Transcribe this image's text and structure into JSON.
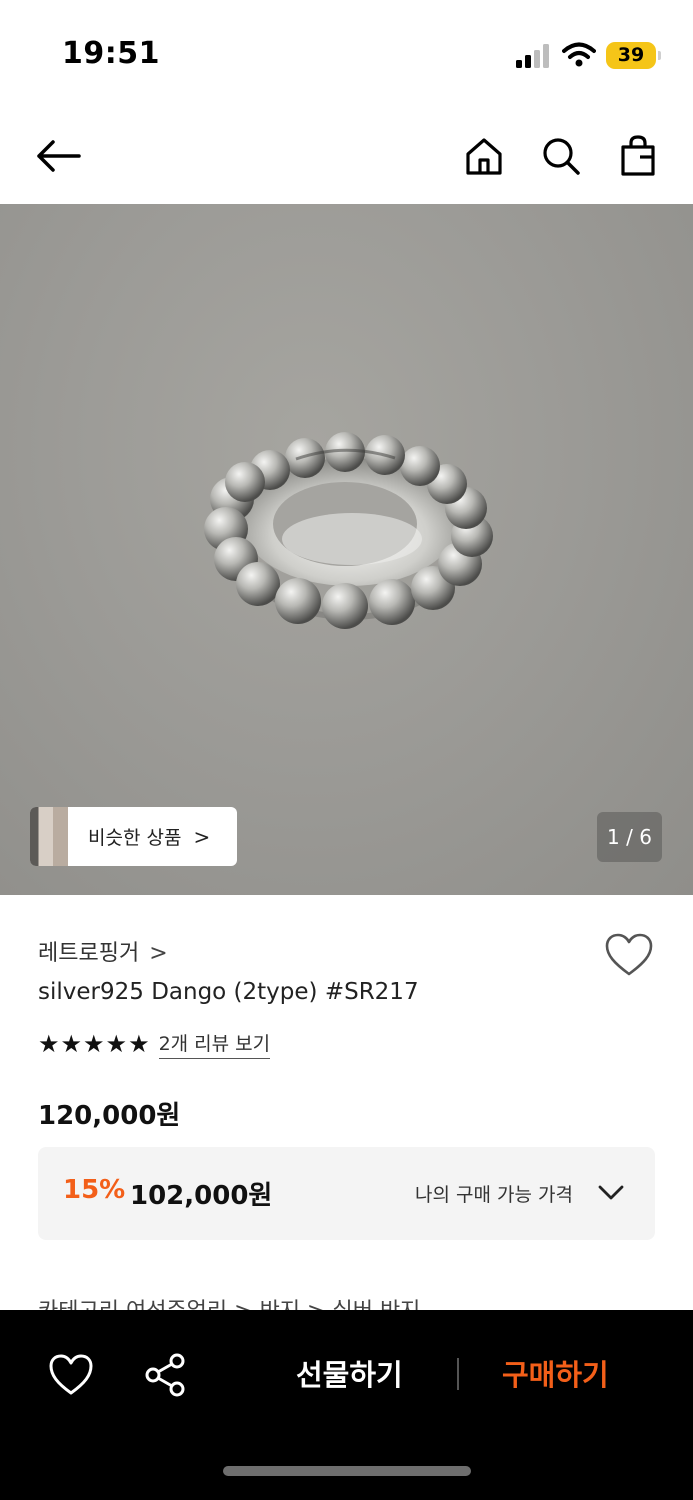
{
  "status_bar": {
    "time": "19:51",
    "battery": "39"
  },
  "nav": {
    "back_icon": "arrow-left-icon",
    "home_icon": "home-icon",
    "search_icon": "search-icon",
    "bag_icon": "shopping-bag-icon"
  },
  "gallery": {
    "similar_label": "비슷한 상품",
    "similar_chevron": ">",
    "page_indicator": "1 / 6"
  },
  "product": {
    "brand": "레트로핑거",
    "brand_chevron": ">",
    "title": "silver925 Dango (2type) #SR217",
    "stars": "★★★★★",
    "review_link": "2개 리뷰 보기",
    "original_price": "120,000원",
    "discount_rate": "15%",
    "sale_price": "102,000원",
    "my_price_label": "나의 구매 가능 가격",
    "breadcrumb": "카테고리     여성주얼리  >  반지  >  실버 반지"
  },
  "bottom_bar": {
    "gift_label": "선물하기",
    "buy_label": "구매하기"
  },
  "colors": {
    "accent": "#f35f19",
    "battery": "#f5c518",
    "bottom_bar": "#000000"
  }
}
